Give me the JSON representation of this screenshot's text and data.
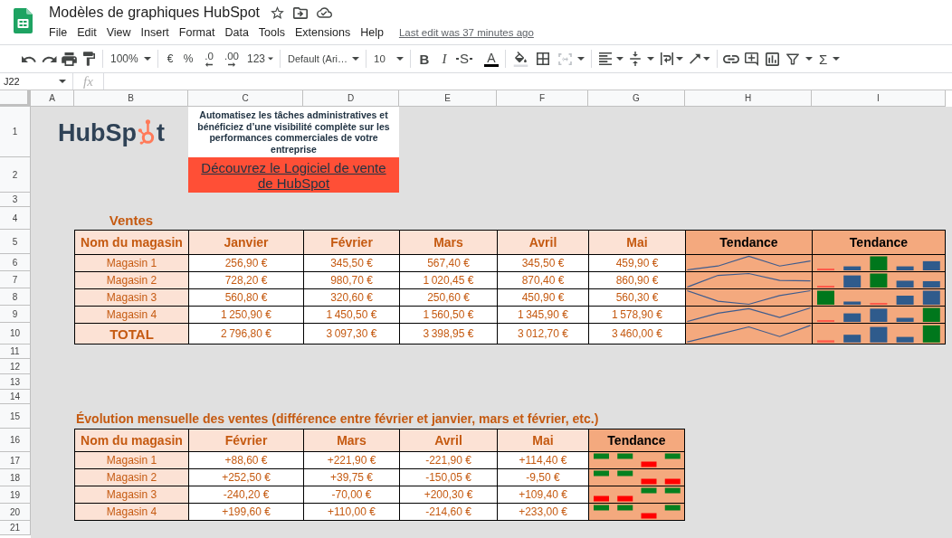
{
  "app": {
    "title": "Modèles de graphiques HubSpot",
    "menu": [
      "File",
      "Edit",
      "View",
      "Insert",
      "Format",
      "Data",
      "Tools",
      "Extensions",
      "Help"
    ],
    "last_edit": "Last edit was 37 minutes ago"
  },
  "toolbar": {
    "zoom": "100%",
    "currency": "€",
    "percent": "%",
    "decimals_less": ".0",
    "decimals_more": ".00",
    "number_format": "123",
    "font": "Default (Ari…",
    "font_size": "10",
    "bold": "B",
    "italic": "I",
    "strikethrough": "S",
    "text_color": "A",
    "functions": "Σ"
  },
  "formula_bar": {
    "cell": "J22",
    "function_label": "fx"
  },
  "sheet": {
    "columns": [
      "A",
      "B",
      "C",
      "D",
      "E",
      "F",
      "G",
      "H",
      "I"
    ],
    "rows": [
      "1",
      "2",
      "3",
      "4",
      "5",
      "6",
      "7",
      "8",
      "9",
      "10",
      "11",
      "12",
      "13",
      "14",
      "15",
      "16",
      "17",
      "18",
      "19",
      "20",
      "21"
    ]
  },
  "logo": {
    "text_start": "HubSp",
    "text_end": "t"
  },
  "promo": {
    "text": "Automatisez les tâches administratives et bénéficiez d’une visibilité complète sur les performances commerciales de votre entreprise",
    "link": "Découvrez le Logiciel de vente de HubSpot"
  },
  "sales": {
    "title": "Ventes",
    "columns": [
      {
        "label": "Nom du magasin",
        "kind": "name"
      },
      {
        "label": "Janvier",
        "kind": "month"
      },
      {
        "label": "Février",
        "kind": "month"
      },
      {
        "label": "Mars",
        "kind": "month"
      },
      {
        "label": "Avril",
        "kind": "month"
      },
      {
        "label": "Mai",
        "kind": "month"
      },
      {
        "label": "Tendance",
        "kind": "line"
      },
      {
        "label": "Tendance",
        "kind": "column"
      }
    ],
    "rows": [
      {
        "kind": "store",
        "name": "Magasin 1",
        "values": [
          "256,90 €",
          "345,50 €",
          "567,40 €",
          "345,50 €",
          "459,90 €"
        ]
      },
      {
        "kind": "store",
        "name": "Magasin 2",
        "values": [
          "728,20 €",
          "980,70 €",
          "1 020,45 €",
          "870,40 €",
          "860,90 €"
        ]
      },
      {
        "kind": "store",
        "name": "Magasin 3",
        "values": [
          "560,80 €",
          "320,60 €",
          "250,60 €",
          "450,90 €",
          "560,30 €"
        ]
      },
      {
        "kind": "store",
        "name": "Magasin 4",
        "values": [
          "1 250,90 €",
          "1 450,50 €",
          "1 560,50 €",
          "1 345,90 €",
          "1 578,90 €"
        ]
      },
      {
        "kind": "total",
        "name": "TOTAL",
        "values": [
          "2 796,80 €",
          "3 097,30 €",
          "3 398,95 €",
          "3 012,70 €",
          "3 460,00 €"
        ]
      }
    ]
  },
  "evolution": {
    "title": "Évolution mensuelle des ventes (différence entre février et janvier, mars et février, etc.)",
    "columns": [
      {
        "label": "Nom du magasin",
        "kind": "name"
      },
      {
        "label": "Février",
        "kind": "month"
      },
      {
        "label": "Mars",
        "kind": "month"
      },
      {
        "label": "Avril",
        "kind": "month"
      },
      {
        "label": "Mai",
        "kind": "month"
      },
      {
        "label": "Tendance",
        "kind": "winloss"
      }
    ],
    "rows": [
      {
        "name": "Magasin 1",
        "values": [
          "+88,60 €",
          "+221,90 €",
          "-221,90 €",
          "+114,40 €"
        ]
      },
      {
        "name": "Magasin 2",
        "values": [
          "+252,50 €",
          "+39,75 €",
          "-150,05 €",
          "-9,50 €"
        ]
      },
      {
        "name": "Magasin 3",
        "values": [
          "-240,20 €",
          "-70,00 €",
          "+200,30 €",
          "+109,40 €"
        ]
      },
      {
        "name": "Magasin 4",
        "values": [
          "+199,60 €",
          "+110,00 €",
          "-214,60 €",
          "+233,00 €"
        ]
      }
    ]
  }
}
